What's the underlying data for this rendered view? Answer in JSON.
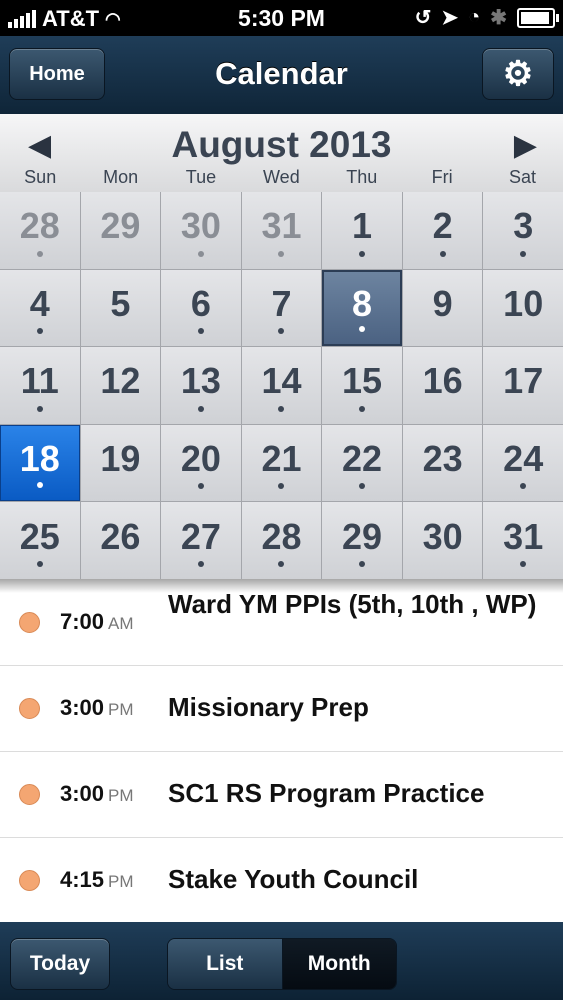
{
  "status_bar": {
    "carrier": "AT&T",
    "time": "5:30 PM"
  },
  "nav": {
    "home_label": "Home",
    "title": "Calendar",
    "settings_icon": "gear-icon"
  },
  "month": {
    "title": "August 2013",
    "prev_icon": "left-arrow-icon",
    "next_icon": "right-arrow-icon"
  },
  "days_of_week": [
    "Sun",
    "Mon",
    "Tue",
    "Wed",
    "Thu",
    "Fri",
    "Sat"
  ],
  "calendar_days": [
    {
      "day": "28",
      "other": true,
      "dot": true
    },
    {
      "day": "29",
      "other": true,
      "dot": false
    },
    {
      "day": "30",
      "other": true,
      "dot": true
    },
    {
      "day": "31",
      "other": true,
      "dot": true
    },
    {
      "day": "1",
      "dot": true
    },
    {
      "day": "2",
      "dot": true
    },
    {
      "day": "3",
      "dot": true
    },
    {
      "day": "4",
      "dot": true
    },
    {
      "day": "5",
      "dot": false
    },
    {
      "day": "6",
      "dot": true
    },
    {
      "day": "7",
      "dot": true
    },
    {
      "day": "8",
      "dot": true,
      "selected": true
    },
    {
      "day": "9",
      "dot": false
    },
    {
      "day": "10",
      "dot": false
    },
    {
      "day": "11",
      "dot": true
    },
    {
      "day": "12",
      "dot": false
    },
    {
      "day": "13",
      "dot": true
    },
    {
      "day": "14",
      "dot": true
    },
    {
      "day": "15",
      "dot": true
    },
    {
      "day": "16",
      "dot": false
    },
    {
      "day": "17",
      "dot": false
    },
    {
      "day": "18",
      "dot": true,
      "today": true
    },
    {
      "day": "19",
      "dot": false
    },
    {
      "day": "20",
      "dot": true
    },
    {
      "day": "21",
      "dot": true
    },
    {
      "day": "22",
      "dot": true
    },
    {
      "day": "23",
      "dot": false
    },
    {
      "day": "24",
      "dot": true
    },
    {
      "day": "25",
      "dot": true
    },
    {
      "day": "26",
      "dot": false
    },
    {
      "day": "27",
      "dot": true
    },
    {
      "day": "28",
      "dot": true
    },
    {
      "day": "29",
      "dot": true
    },
    {
      "day": "30",
      "dot": false
    },
    {
      "day": "31",
      "dot": true
    }
  ],
  "events": [
    {
      "time": "7:00",
      "ampm": "AM",
      "title": "Ward YM PPIs (5th, 10th , WP)",
      "color": "#f4a672"
    },
    {
      "time": "3:00",
      "ampm": "PM",
      "title": "Missionary Prep",
      "color": "#f4a672"
    },
    {
      "time": "3:00",
      "ampm": "PM",
      "title": "SC1 RS Program Practice",
      "color": "#f4a672"
    },
    {
      "time": "4:15",
      "ampm": "PM",
      "title": "Stake Youth Council",
      "color": "#f4a672"
    }
  ],
  "toolbar": {
    "today_label": "Today",
    "list_label": "List",
    "month_label": "Month"
  }
}
